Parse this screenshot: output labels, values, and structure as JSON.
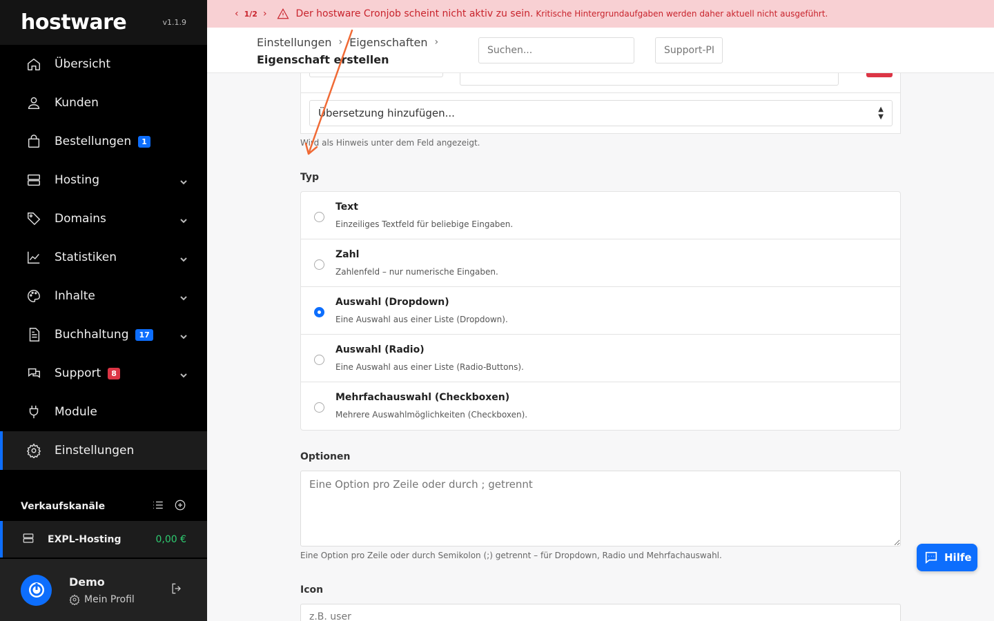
{
  "sidebar": {
    "logo": "hostware",
    "version": "v1.1.9",
    "items": [
      {
        "label": "Übersicht",
        "icon": "home-icon"
      },
      {
        "label": "Kunden",
        "icon": "user-icon"
      },
      {
        "label": "Bestellungen",
        "icon": "bag-icon",
        "badge": "1"
      },
      {
        "label": "Hosting",
        "icon": "server-icon"
      },
      {
        "label": "Domains",
        "icon": "tag-icon"
      },
      {
        "label": "Statistiken",
        "icon": "chart-icon"
      },
      {
        "label": "Inhalte",
        "icon": "palette-icon"
      },
      {
        "label": "Buchhaltung",
        "icon": "document-icon",
        "badge": "17"
      },
      {
        "label": "Support",
        "icon": "chat-icon",
        "badge": "8"
      },
      {
        "label": "Module",
        "icon": "plug-icon"
      },
      {
        "label": "Einstellungen",
        "icon": "gear-icon"
      }
    ],
    "channels_title": "Verkaufskanäle",
    "channel": {
      "name": "EXPL-Hosting",
      "price": "0,00 €"
    },
    "profile": {
      "name": "Demo",
      "link": "Mein Profil"
    }
  },
  "alert": {
    "page": "1/2",
    "main": "Der hostware Cronjob scheint nicht aktiv zu sein.",
    "detail": "Kritische Hintergrundaufgaben werden daher aktuell nicht ausgeführt."
  },
  "header": {
    "crumb1": "Einstellungen",
    "crumb2": "Eigenschaften",
    "crumb3": "Eigenschaft erstellen",
    "search_placeholder": "Suchen...",
    "support_pin_placeholder": "Support-PI"
  },
  "form": {
    "translation_select": "Übersetzung hinzufügen...",
    "translation_hint": "Wird als Hinweis unter dem Feld angezeigt.",
    "type_label": "Typ",
    "types": [
      {
        "title": "Text",
        "desc": "Einzeiliges Textfeld für beliebige Eingaben.",
        "selected": false
      },
      {
        "title": "Zahl",
        "desc": "Zahlenfeld – nur numerische Eingaben.",
        "selected": false
      },
      {
        "title": "Auswahl (Dropdown)",
        "desc": "Eine Auswahl aus einer Liste (Dropdown).",
        "selected": true
      },
      {
        "title": "Auswahl (Radio)",
        "desc": "Eine Auswahl aus einer Liste (Radio-Buttons).",
        "selected": false
      },
      {
        "title": "Mehrfachauswahl (Checkboxen)",
        "desc": "Mehrere Auswahlmöglichkeiten (Checkboxen).",
        "selected": false
      }
    ],
    "options_label": "Optionen",
    "options_placeholder": "Eine Option pro Zeile oder durch ; getrennt",
    "options_hint": "Eine Option pro Zeile oder durch Semikolon (;) getrennt – für Dropdown, Radio und Mehrfachauswahl.",
    "icon_label": "Icon",
    "icon_placeholder": "z.B. user"
  },
  "help_button": "Hilfe",
  "colors": {
    "accent": "#0d6efd",
    "alert_bg": "#f8d0d3",
    "alert_text": "#c8232c",
    "annotation_arrow": "#f06a35"
  }
}
